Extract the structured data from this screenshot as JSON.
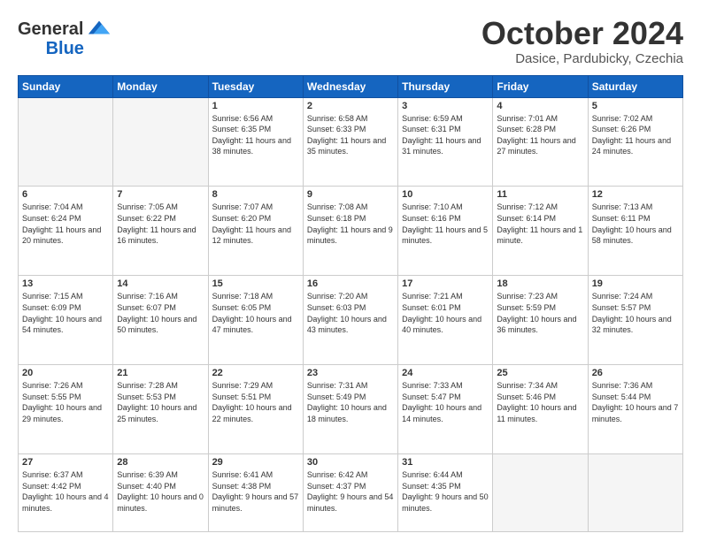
{
  "logo": {
    "general": "General",
    "blue": "Blue"
  },
  "header": {
    "month": "October 2024",
    "location": "Dasice, Pardubicky, Czechia"
  },
  "days_of_week": [
    "Sunday",
    "Monday",
    "Tuesday",
    "Wednesday",
    "Thursday",
    "Friday",
    "Saturday"
  ],
  "weeks": [
    [
      {
        "day": "",
        "info": ""
      },
      {
        "day": "",
        "info": ""
      },
      {
        "day": "1",
        "info": "Sunrise: 6:56 AM\nSunset: 6:35 PM\nDaylight: 11 hours and 38 minutes."
      },
      {
        "day": "2",
        "info": "Sunrise: 6:58 AM\nSunset: 6:33 PM\nDaylight: 11 hours and 35 minutes."
      },
      {
        "day": "3",
        "info": "Sunrise: 6:59 AM\nSunset: 6:31 PM\nDaylight: 11 hours and 31 minutes."
      },
      {
        "day": "4",
        "info": "Sunrise: 7:01 AM\nSunset: 6:28 PM\nDaylight: 11 hours and 27 minutes."
      },
      {
        "day": "5",
        "info": "Sunrise: 7:02 AM\nSunset: 6:26 PM\nDaylight: 11 hours and 24 minutes."
      }
    ],
    [
      {
        "day": "6",
        "info": "Sunrise: 7:04 AM\nSunset: 6:24 PM\nDaylight: 11 hours and 20 minutes."
      },
      {
        "day": "7",
        "info": "Sunrise: 7:05 AM\nSunset: 6:22 PM\nDaylight: 11 hours and 16 minutes."
      },
      {
        "day": "8",
        "info": "Sunrise: 7:07 AM\nSunset: 6:20 PM\nDaylight: 11 hours and 12 minutes."
      },
      {
        "day": "9",
        "info": "Sunrise: 7:08 AM\nSunset: 6:18 PM\nDaylight: 11 hours and 9 minutes."
      },
      {
        "day": "10",
        "info": "Sunrise: 7:10 AM\nSunset: 6:16 PM\nDaylight: 11 hours and 5 minutes."
      },
      {
        "day": "11",
        "info": "Sunrise: 7:12 AM\nSunset: 6:14 PM\nDaylight: 11 hours and 1 minute."
      },
      {
        "day": "12",
        "info": "Sunrise: 7:13 AM\nSunset: 6:11 PM\nDaylight: 10 hours and 58 minutes."
      }
    ],
    [
      {
        "day": "13",
        "info": "Sunrise: 7:15 AM\nSunset: 6:09 PM\nDaylight: 10 hours and 54 minutes."
      },
      {
        "day": "14",
        "info": "Sunrise: 7:16 AM\nSunset: 6:07 PM\nDaylight: 10 hours and 50 minutes."
      },
      {
        "day": "15",
        "info": "Sunrise: 7:18 AM\nSunset: 6:05 PM\nDaylight: 10 hours and 47 minutes."
      },
      {
        "day": "16",
        "info": "Sunrise: 7:20 AM\nSunset: 6:03 PM\nDaylight: 10 hours and 43 minutes."
      },
      {
        "day": "17",
        "info": "Sunrise: 7:21 AM\nSunset: 6:01 PM\nDaylight: 10 hours and 40 minutes."
      },
      {
        "day": "18",
        "info": "Sunrise: 7:23 AM\nSunset: 5:59 PM\nDaylight: 10 hours and 36 minutes."
      },
      {
        "day": "19",
        "info": "Sunrise: 7:24 AM\nSunset: 5:57 PM\nDaylight: 10 hours and 32 minutes."
      }
    ],
    [
      {
        "day": "20",
        "info": "Sunrise: 7:26 AM\nSunset: 5:55 PM\nDaylight: 10 hours and 29 minutes."
      },
      {
        "day": "21",
        "info": "Sunrise: 7:28 AM\nSunset: 5:53 PM\nDaylight: 10 hours and 25 minutes."
      },
      {
        "day": "22",
        "info": "Sunrise: 7:29 AM\nSunset: 5:51 PM\nDaylight: 10 hours and 22 minutes."
      },
      {
        "day": "23",
        "info": "Sunrise: 7:31 AM\nSunset: 5:49 PM\nDaylight: 10 hours and 18 minutes."
      },
      {
        "day": "24",
        "info": "Sunrise: 7:33 AM\nSunset: 5:47 PM\nDaylight: 10 hours and 14 minutes."
      },
      {
        "day": "25",
        "info": "Sunrise: 7:34 AM\nSunset: 5:46 PM\nDaylight: 10 hours and 11 minutes."
      },
      {
        "day": "26",
        "info": "Sunrise: 7:36 AM\nSunset: 5:44 PM\nDaylight: 10 hours and 7 minutes."
      }
    ],
    [
      {
        "day": "27",
        "info": "Sunrise: 6:37 AM\nSunset: 4:42 PM\nDaylight: 10 hours and 4 minutes."
      },
      {
        "day": "28",
        "info": "Sunrise: 6:39 AM\nSunset: 4:40 PM\nDaylight: 10 hours and 0 minutes."
      },
      {
        "day": "29",
        "info": "Sunrise: 6:41 AM\nSunset: 4:38 PM\nDaylight: 9 hours and 57 minutes."
      },
      {
        "day": "30",
        "info": "Sunrise: 6:42 AM\nSunset: 4:37 PM\nDaylight: 9 hours and 54 minutes."
      },
      {
        "day": "31",
        "info": "Sunrise: 6:44 AM\nSunset: 4:35 PM\nDaylight: 9 hours and 50 minutes."
      },
      {
        "day": "",
        "info": ""
      },
      {
        "day": "",
        "info": ""
      }
    ]
  ]
}
